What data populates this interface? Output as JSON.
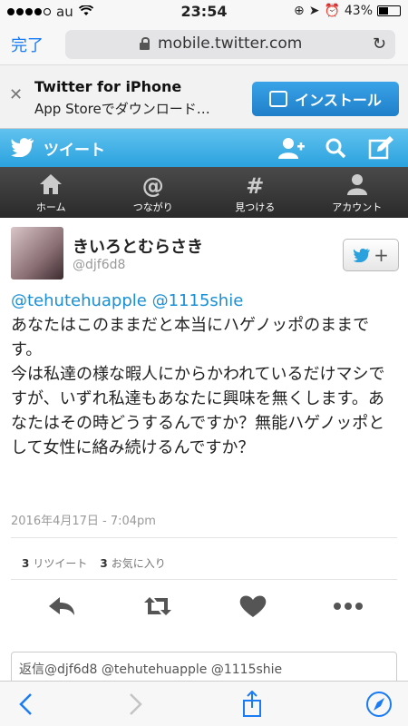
{
  "status": {
    "carrier": "au",
    "time": "23:54",
    "battery": "43%",
    "battery_level": 0.43,
    "signal_bars": 4
  },
  "browser": {
    "done_label": "完了",
    "url": "mobile.twitter.com"
  },
  "banner": {
    "title": "Twitter for iPhone",
    "subtitle": "App Storeでダウンロード…",
    "install_label": "インストール"
  },
  "header": {
    "title": "ツイート"
  },
  "nav": {
    "items": [
      {
        "label": "ホーム",
        "icon": "home-icon"
      },
      {
        "label": "つながり",
        "icon": "at-icon"
      },
      {
        "label": "見つける",
        "icon": "hash-icon"
      },
      {
        "label": "アカウント",
        "icon": "person-icon"
      }
    ]
  },
  "tweet": {
    "name": "きいろとむらさき",
    "handle": "@djf6d8",
    "mention1": "@tehutehuapple",
    "mention2": "@1115shie",
    "text": "あなたはこのままだと本当にハゲノッポのままです。\n今は私達の様な暇人にからかわれているだけマシですが、いずれ私達もあなたに興味を無くします。あなたはその時どうするんですか？無能ハゲノッポとして女性に絡み続けるんですか？",
    "date": "2016年4月17日 - 7:04pm",
    "retweet_count": "3",
    "retweet_label": "リツイート",
    "fav_count": "3",
    "fav_label": "お気に入り"
  },
  "reply": {
    "placeholder": "返信@djf6d8 @tehutehuapple @1115shie"
  }
}
